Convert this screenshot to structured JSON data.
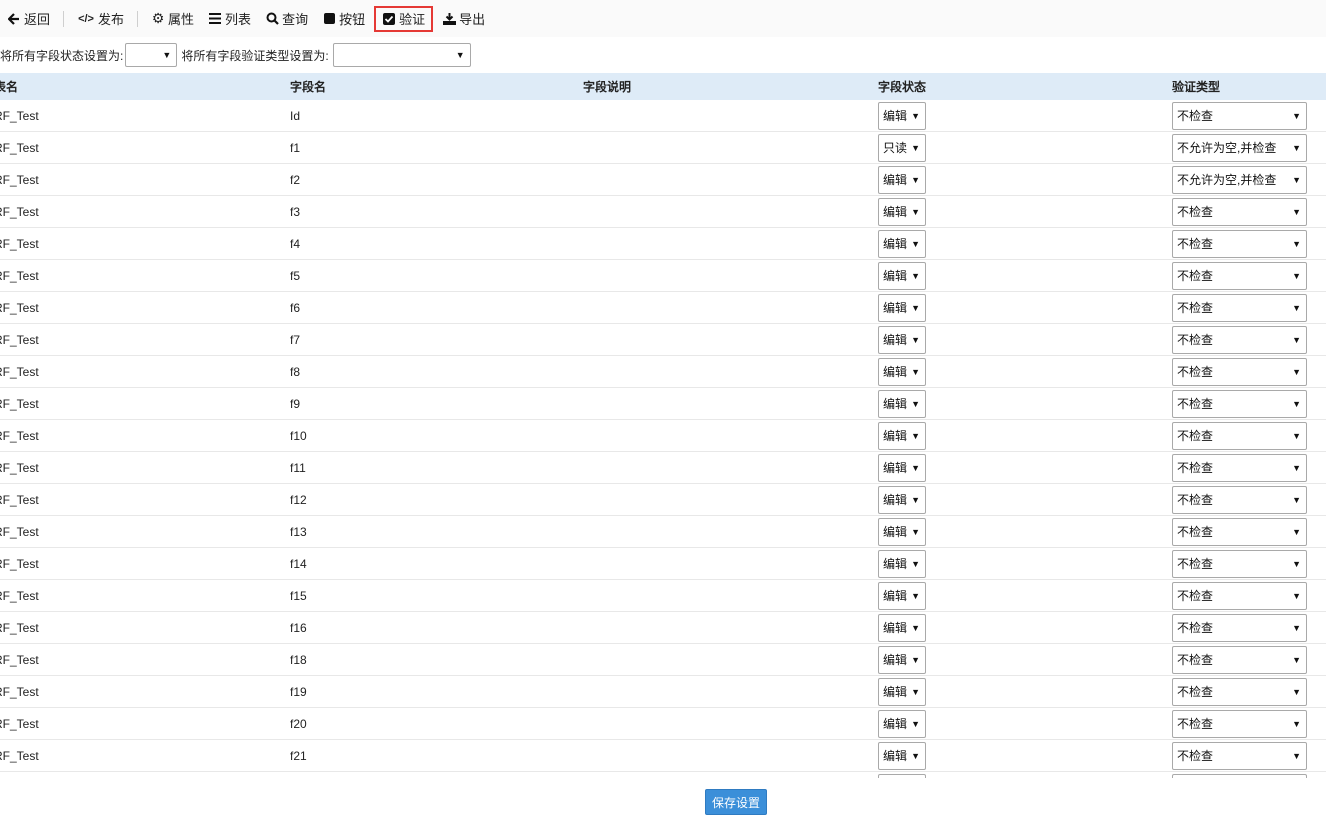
{
  "toolbar": {
    "back": "返回",
    "publish": "发布",
    "properties": "属性",
    "list": "列表",
    "query": "查询",
    "button": "按钮",
    "verify": "验证",
    "export": "导出"
  },
  "filters": {
    "status_label": "将所有字段状态设置为:",
    "status_value": "",
    "verify_label": "将所有字段验证类型设置为:",
    "verify_value": ""
  },
  "table": {
    "headers": [
      "表名",
      "字段名",
      "字段说明",
      "字段状态",
      "验证类型"
    ],
    "rows": [
      {
        "table": "RF_Test",
        "field": "Id",
        "desc": "",
        "status": "编辑",
        "verify": "不检查"
      },
      {
        "table": "RF_Test",
        "field": "f1",
        "desc": "",
        "status": "只读",
        "verify": "不允许为空,并检查"
      },
      {
        "table": "RF_Test",
        "field": "f2",
        "desc": "",
        "status": "编辑",
        "verify": "不允许为空,并检查"
      },
      {
        "table": "RF_Test",
        "field": "f3",
        "desc": "",
        "status": "编辑",
        "verify": "不检查"
      },
      {
        "table": "RF_Test",
        "field": "f4",
        "desc": "",
        "status": "编辑",
        "verify": "不检查"
      },
      {
        "table": "RF_Test",
        "field": "f5",
        "desc": "",
        "status": "编辑",
        "verify": "不检查"
      },
      {
        "table": "RF_Test",
        "field": "f6",
        "desc": "",
        "status": "编辑",
        "verify": "不检查"
      },
      {
        "table": "RF_Test",
        "field": "f7",
        "desc": "",
        "status": "编辑",
        "verify": "不检查"
      },
      {
        "table": "RF_Test",
        "field": "f8",
        "desc": "",
        "status": "编辑",
        "verify": "不检查"
      },
      {
        "table": "RF_Test",
        "field": "f9",
        "desc": "",
        "status": "编辑",
        "verify": "不检查"
      },
      {
        "table": "RF_Test",
        "field": "f10",
        "desc": "",
        "status": "编辑",
        "verify": "不检查"
      },
      {
        "table": "RF_Test",
        "field": "f11",
        "desc": "",
        "status": "编辑",
        "verify": "不检查"
      },
      {
        "table": "RF_Test",
        "field": "f12",
        "desc": "",
        "status": "编辑",
        "verify": "不检查"
      },
      {
        "table": "RF_Test",
        "field": "f13",
        "desc": "",
        "status": "编辑",
        "verify": "不检查"
      },
      {
        "table": "RF_Test",
        "field": "f14",
        "desc": "",
        "status": "编辑",
        "verify": "不检查"
      },
      {
        "table": "RF_Test",
        "field": "f15",
        "desc": "",
        "status": "编辑",
        "verify": "不检查"
      },
      {
        "table": "RF_Test",
        "field": "f16",
        "desc": "",
        "status": "编辑",
        "verify": "不检查"
      },
      {
        "table": "RF_Test",
        "field": "f18",
        "desc": "",
        "status": "编辑",
        "verify": "不检查"
      },
      {
        "table": "RF_Test",
        "field": "f19",
        "desc": "",
        "status": "编辑",
        "verify": "不检查"
      },
      {
        "table": "RF_Test",
        "field": "f20",
        "desc": "",
        "status": "编辑",
        "verify": "不检查"
      },
      {
        "table": "RF_Test",
        "field": "f21",
        "desc": "",
        "status": "编辑",
        "verify": "不检查"
      },
      {
        "table": "",
        "field": "",
        "desc": "",
        "status": "",
        "verify": ""
      }
    ]
  },
  "footer": {
    "save_label": "保存设置"
  },
  "colors": {
    "header_bg": "#deebf7",
    "primary_button": "#3b8fd9",
    "active_highlight": "#e53935"
  }
}
